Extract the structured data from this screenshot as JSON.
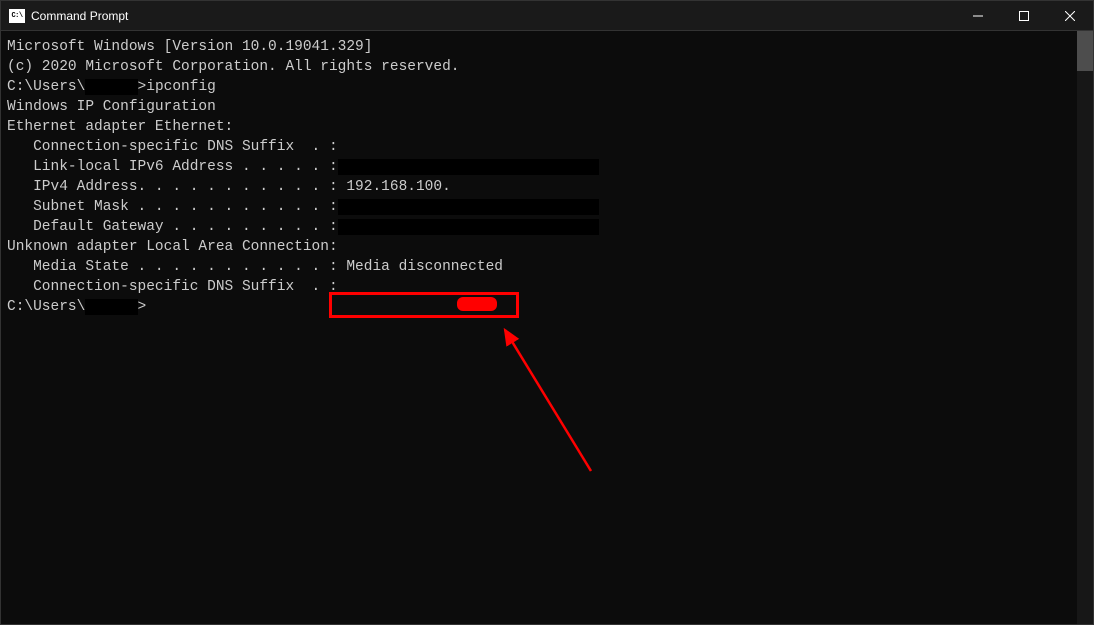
{
  "titlebar": {
    "title": "Command Prompt"
  },
  "terminal": {
    "line1": "Microsoft Windows [Version 10.0.19041.329]",
    "line2": "(c) 2020 Microsoft Corporation. All rights reserved.",
    "blank1": "",
    "prompt1_prefix": "C:\\Users\\",
    "prompt1_user": "      ",
    "prompt1_cmd": ">ipconfig",
    "blank2": "",
    "blank3": "",
    "ipconfig_title": "Windows IP Configuration",
    "blank4": "",
    "blank5": "",
    "adapter1_title": "Ethernet adapter Ethernet:",
    "blank6": "",
    "dns_suffix": "   Connection-specific DNS Suffix  . :",
    "ipv6_label": "   Link-local IPv6 Address . . . . . :",
    "ipv6_value": "                              ",
    "ipv4_label": "   IPv4 Address. . . . . . . . . . . :",
    "ipv4_value": " 192.168.100.",
    "subnet_label": "   Subnet Mask . . . . . . . . . . . :",
    "subnet_value": "                              ",
    "gateway_label": "   Default Gateway . . . . . . . . . :",
    "gateway_value": "                              ",
    "blank7": "",
    "blank8": "",
    "adapter2_title": "Unknown adapter Local Area Connection:",
    "blank9": "",
    "media_state": "   Media State . . . . . . . . . . . : Media disconnected",
    "dns_suffix2": "   Connection-specific DNS Suffix  . :",
    "blank10": "",
    "prompt2_prefix": "C:\\Users\\",
    "prompt2_user": "      ",
    "prompt2_cmd": ">"
  }
}
